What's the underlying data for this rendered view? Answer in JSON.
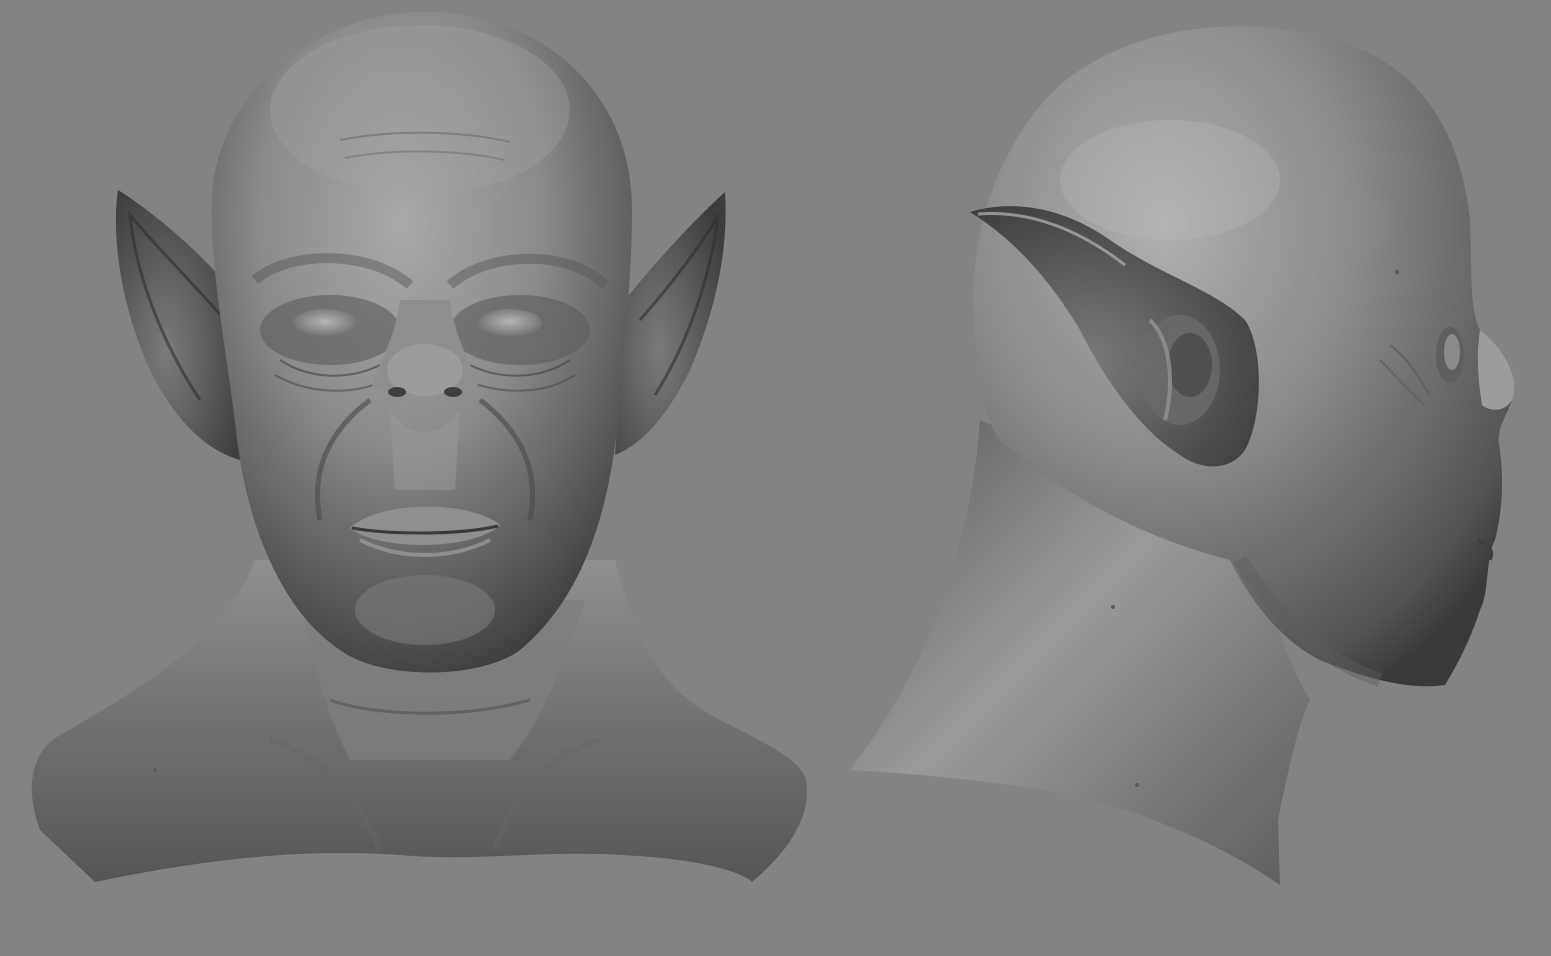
{
  "scene": {
    "background": "#838383",
    "views": [
      {
        "view": "front"
      },
      {
        "view": "side"
      }
    ],
    "material_tone": "#8c8c8c"
  }
}
